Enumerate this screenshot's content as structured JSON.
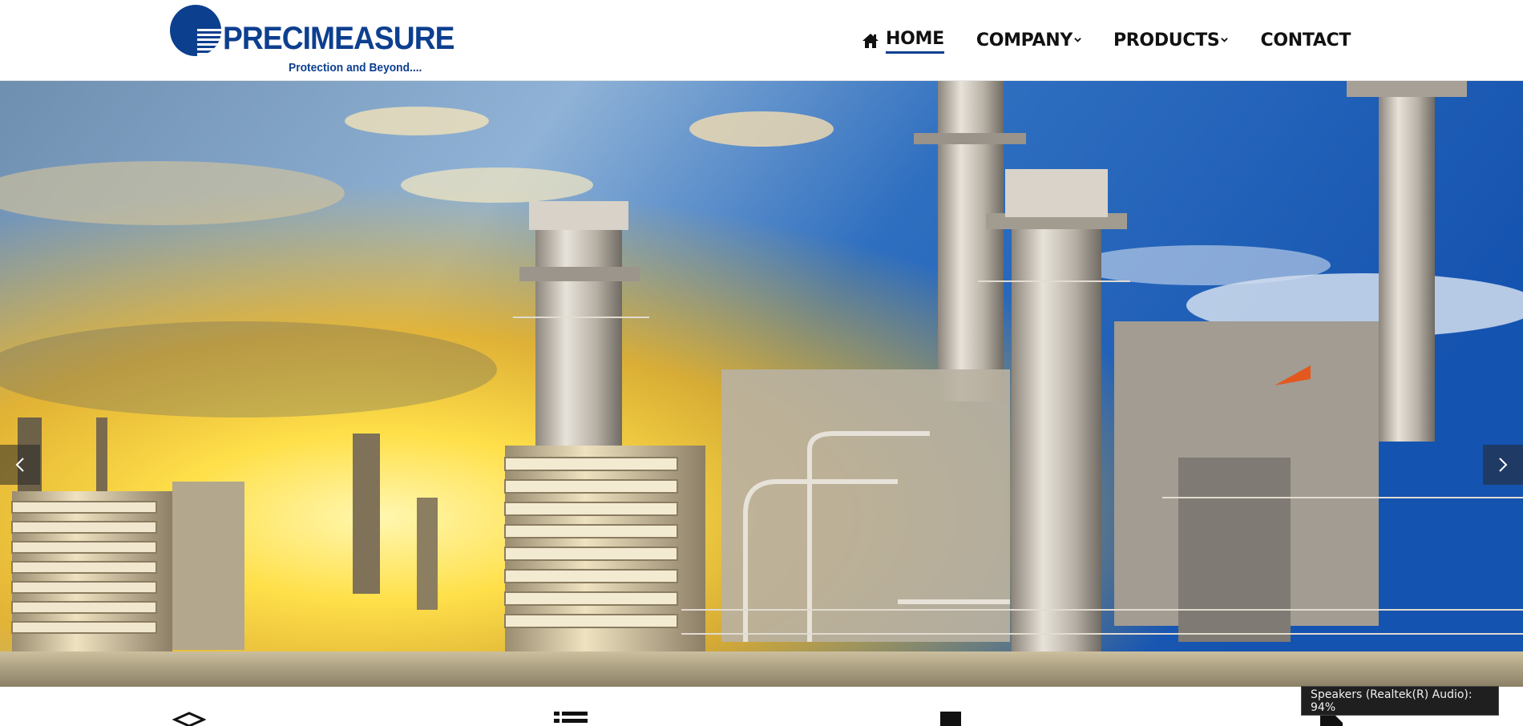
{
  "brand": {
    "name": "PRECIMEASURE",
    "tagline": "Protection and Beyond....",
    "color": "#0d3f8f"
  },
  "nav": {
    "items": [
      {
        "label": "HOME",
        "icon": "home-icon",
        "active": true
      },
      {
        "label": "COMPANY",
        "icon": "chevron-down-icon",
        "has_dropdown": true
      },
      {
        "label": "PRODUCTS",
        "icon": "chevron-down-icon",
        "has_dropdown": true
      },
      {
        "label": "CONTACT"
      }
    ]
  },
  "hero": {
    "image": "power-plant-at-sunset",
    "prev_icon": "chevron-left-icon",
    "next_icon": "chevron-right-icon"
  },
  "features": {
    "icons": [
      "layers-icon",
      "list-icon",
      "bookmark-icon",
      "document-icon"
    ]
  },
  "system_tooltip": {
    "text": "Speakers (Realtek(R) Audio): 94%"
  }
}
